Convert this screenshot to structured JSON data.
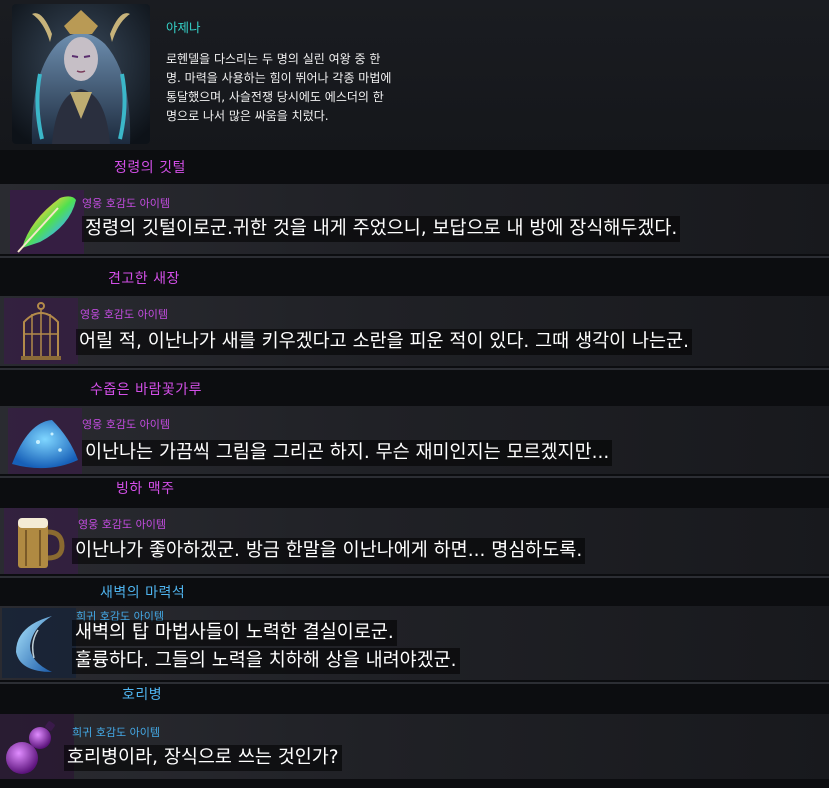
{
  "npc": {
    "name": "아제나",
    "description_lines": [
      "로헨델을 다스리는 두 명의 실린 여왕 중 한",
      "명. 마력을 사용하는 힘이 뛰어나 각종 마법에",
      "통달했으며, 사슬전쟁 당시에도 에스더의 한",
      "명으로 나서 많은 싸움을 치렀다."
    ]
  },
  "items": [
    {
      "title": "정령의 깃털",
      "grade": "hero",
      "type_label": "영웅 호감도 아이템",
      "icon": "feather-icon",
      "lines": [
        "정령의 깃털이로군.귀한 것을 내게 주었으니, 보답으로 내 방에 장식해두겠다."
      ]
    },
    {
      "title": "견고한 새장",
      "grade": "hero",
      "type_label": "영웅 호감도 아이템",
      "icon": "birdcage-icon",
      "lines": [
        "어릴 적, 이난나가 새를 키우겠다고 소란을 피운 적이 있다. 그때 생각이 나는군."
      ]
    },
    {
      "title": "수줍은 바람꽃가루",
      "grade": "hero",
      "type_label": "영웅 호감도 아이템",
      "icon": "powder-pile-icon",
      "lines": [
        "이난나는 가끔씩 그림을 그리곤 하지. 무슨 재미인지는 모르겠지만..."
      ]
    },
    {
      "title": "빙하 맥주",
      "grade": "hero",
      "type_label": "영웅 호감도 아이템",
      "icon": "beer-mug-icon",
      "lines": [
        "이난나가 좋아하겠군. 방금 한말을 이난나에게 하면... 명심하도록."
      ]
    },
    {
      "title": "새벽의 마력석",
      "grade": "rare",
      "type_label": "희귀 호감도 아이템",
      "icon": "crescent-crystal-icon",
      "lines": [
        "새벽의 탑 마법사들이 노력한 결실이로군.",
        "훌륭하다. 그들의 노력을 치하해 상을 내려야겠군."
      ]
    },
    {
      "title": "호리병",
      "grade": "rare",
      "type_label": "희귀 호감도 아이템",
      "icon": "gourd-bottle-icon",
      "lines": [
        "호리병이라, 장식으로 쓰는 것인가?"
      ]
    }
  ],
  "colors": {
    "hero": "#c34ce0",
    "rare": "#44a9e6",
    "npc_name": "#35d2c8"
  }
}
